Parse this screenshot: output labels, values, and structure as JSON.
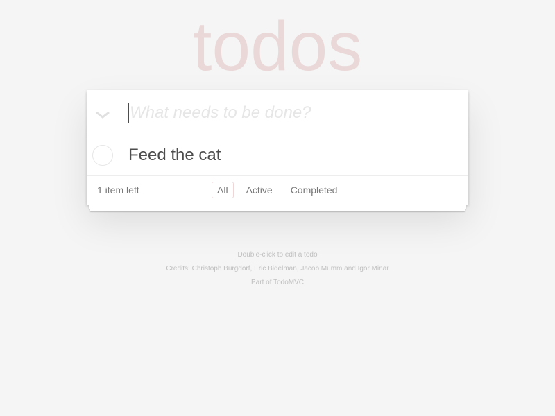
{
  "app": {
    "title": "todos"
  },
  "new_todo": {
    "placeholder": "What needs to be done?",
    "value": "",
    "toggle_all_icon": "chevron-down-icon"
  },
  "todos": [
    {
      "label": "Feed the cat",
      "completed": false
    }
  ],
  "footer": {
    "count": "1 item left",
    "filters": [
      {
        "label": "All",
        "selected": true
      },
      {
        "label": "Active",
        "selected": false
      },
      {
        "label": "Completed",
        "selected": false
      }
    ]
  },
  "info": {
    "hint": "Double-click to edit a todo",
    "credits": "Credits: Christoph Burgdorf, Eric Bidelman, Jacob Mumm and Igor Minar",
    "part_of": "Part of TodoMVC"
  },
  "colors": {
    "title": "#eadada",
    "background": "#f5f5f5",
    "selected_filter_border": "#efd5d5"
  }
}
